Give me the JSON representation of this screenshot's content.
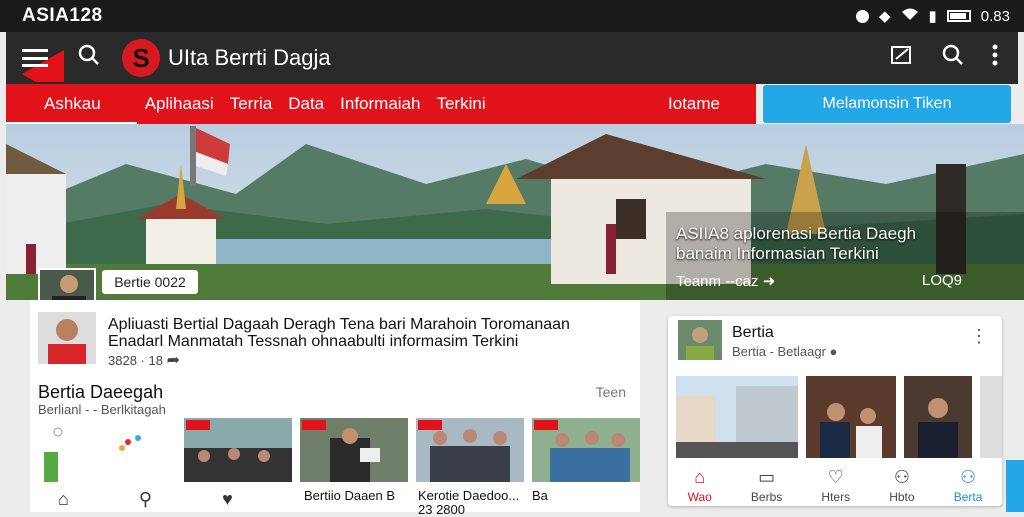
{
  "status": {
    "brand": "ASIA128",
    "time": "0.83"
  },
  "header": {
    "app_title": "UIta Berrti Dagja",
    "logo_letter": "S"
  },
  "nav": {
    "active": "Ashkau",
    "items": [
      "Aplihaasi",
      "Terria",
      "Data",
      "Informaiah",
      "Terkini"
    ],
    "login": "Iotame",
    "subscribe": "Melamonsin Tiken"
  },
  "hero": {
    "headline_1": "ASIIA8 aplorenasi Bertia Daegh",
    "headline_2": "banaim Informasian Terkini",
    "more": "Teanm --caz ➜",
    "count": "LOQ9",
    "badge": "Bertie  0022"
  },
  "article": {
    "title_1": "Apliuasti Bertial Dagaah Deragh Tena bari Marahoin Toromanaan",
    "title_2": "Enadarl Manmatah Tessnah ohnaabulti informasim Terkini",
    "meta": "3828 · 18"
  },
  "section": {
    "title": "Bertia Daeegah",
    "sub": "Berlianl - - Berlkitagah",
    "more": "Teen"
  },
  "captions": {
    "c1": "Bertiio Daaen B",
    "c2": "Kerotie Daedoo...",
    "c3": "23 2800",
    "c4": "Ba"
  },
  "side": {
    "title": "Bertia",
    "sub": "Bertia - Betlaagr ●",
    "tabs": [
      "Wao",
      "Berbs",
      "Hters",
      "Hbto",
      "Berta"
    ]
  },
  "colors": {
    "red": "#e2121b",
    "blue": "#23a7e6",
    "dark": "#2a2a2a"
  }
}
